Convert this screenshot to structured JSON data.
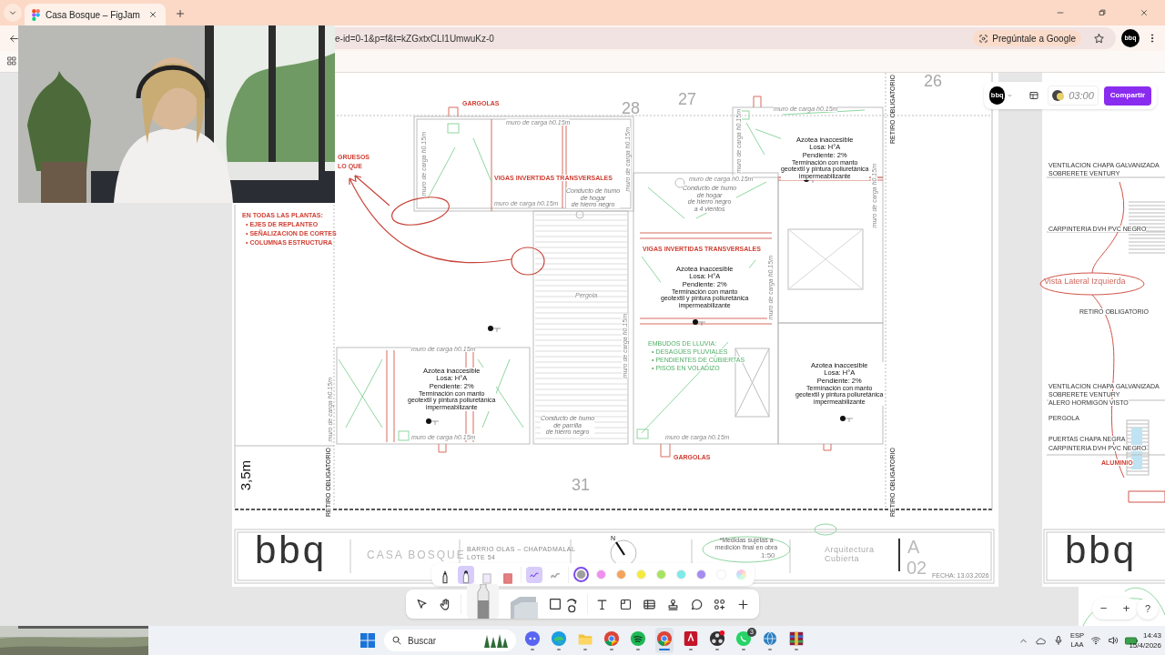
{
  "browser": {
    "tab_title": "Casa Bosque – FigJam",
    "url": "e-id=0-1&p=f&t=kZGxtxCLI1UmwuKz-0",
    "ask_google": "Pregúntale a Google",
    "profile": "bbq"
  },
  "figjam_header": {
    "avatar": "bbq",
    "timer": "03:00",
    "share": "Compartir"
  },
  "plan_labels": [
    {
      "kind": "red",
      "text": "GARGOLAS"
    },
    {
      "kind": "red-large",
      "text": "GRUESOS"
    },
    {
      "kind": "red-large",
      "text": "LO QUE"
    },
    {
      "kind": "red-large",
      "text": "EN TODAS LAS PLANTAS:"
    },
    {
      "kind": "red-large",
      "text": "• EJES DE REPLANTEO"
    },
    {
      "kind": "red-large",
      "text": "• SEÑALIZACION DE CORTES"
    },
    {
      "kind": "red-large",
      "text": "• COLUMNAS ESTRUCTURA"
    },
    {
      "kind": "wall",
      "text": "muro de carga h0.15m"
    },
    {
      "kind": "red",
      "text": "VIGAS INVERTIDAS TRANSVERSALES"
    },
    {
      "kind": "wall",
      "text": "muro de carga h0.15m"
    },
    {
      "kind": "wall",
      "text": "muro de carga h0.15m"
    },
    {
      "kind": "wall",
      "text": "muro de carga h0.15m"
    },
    {
      "kind": "wall",
      "text": "muro de carga h0.15m"
    },
    {
      "kind": "wall",
      "text": "muro de carga h0.15m"
    },
    {
      "kind": "wall",
      "text": "muro de carga h0.15m"
    },
    {
      "kind": "wall",
      "text": "muro de carga h0.15m"
    },
    {
      "kind": "red",
      "text": "VIGAS INVERTIDAS TRANSVERSALES"
    },
    {
      "kind": "wall",
      "text": "muro de carga h0.15m"
    },
    {
      "kind": "wall",
      "text": "muro de carga h0.15m"
    },
    {
      "kind": "wall",
      "text": "Pergola"
    },
    {
      "kind": "green",
      "text": "EMBUDOS DE LLUVIA:"
    },
    {
      "kind": "green",
      "text": "• DESAGÜES PLUVIALES"
    },
    {
      "kind": "green",
      "text": "• PENDIENTES DE CUBIERTAS"
    },
    {
      "kind": "green",
      "text": "• PISOS EN VOLADIZO"
    },
    {
      "kind": "wall",
      "text": "muro de carga h0.15m"
    },
    {
      "kind": "wall",
      "text": "muro de carga h0.15m"
    },
    {
      "kind": "wall",
      "text": "muro de carga h0.15m"
    },
    {
      "kind": "wall",
      "text": "muro de carga h0.15m"
    },
    {
      "kind": "red",
      "text": "GARGOLAS"
    },
    {
      "kind": "setback",
      "text": "RETIRO OBLIGATORIO"
    },
    {
      "kind": "setback",
      "text": "RETIRO OBLIGATORIO"
    },
    {
      "kind": "setback",
      "text": "RETIRO OBLIGATORIO"
    },
    {
      "kind": "dimension",
      "text": "3,5m"
    },
    {
      "kind": "stamp",
      "text": "28"
    },
    {
      "kind": "stamp",
      "text": "27"
    },
    {
      "kind": "stamp",
      "text": "26"
    },
    {
      "kind": "stamp",
      "text": "31"
    },
    {
      "kind": "material",
      "text": "VENTILACION CHAPA GALVANIZADA"
    },
    {
      "kind": "material",
      "text": "SOBRERETE VENTURY"
    },
    {
      "kind": "material",
      "text": "CARPINTERIA DVH PVC NEGRO"
    },
    {
      "kind": "view-title",
      "text": "Vista Lateral Izquierda"
    },
    {
      "kind": "material",
      "text": "RETIRO OBLIGATORIO"
    },
    {
      "kind": "material",
      "text": "VENTILACION CHAPA GALVANIZADA"
    },
    {
      "kind": "material",
      "text": "SOBRERETE VENTURY"
    },
    {
      "kind": "material",
      "text": "ALERO HORMIGON VISTO"
    },
    {
      "kind": "material",
      "text": "PERGOLA"
    },
    {
      "kind": "material",
      "text": "PUERTAS CHAPA NEGRA"
    },
    {
      "kind": "material",
      "text": "CARPINTERIA DVH PVC NEGRO"
    },
    {
      "kind": "red",
      "text": "ALUMINIO"
    }
  ],
  "plan_notes": [
    {
      "kind": "conduit",
      "lines": [
        "Conducto de humo",
        "de hogar",
        "de hierro negro"
      ]
    },
    {
      "kind": "conduit",
      "lines": [
        "Conducto de humo",
        "de hogar",
        "de hierro negro",
        "a 4 vientos"
      ]
    },
    {
      "kind": "conduit",
      "lines": [
        "Conducto de humo",
        "de parrilla",
        "de hierro negro"
      ]
    },
    {
      "kind": "roof",
      "lines": [
        "Azotea inaccesible",
        "Losa: H°A",
        "Pendiente: 2%",
        "Terminación con manto",
        "geotextil y pintura poliuretánica",
        "impermeabilizante"
      ]
    },
    {
      "kind": "roof",
      "lines": [
        "Azotea inaccesible",
        "Losa: H°A",
        "Pendiente: 2%",
        "Terminación con manto",
        "geotextil y pintura poliuretánica",
        "impermeabilizante"
      ]
    },
    {
      "kind": "roof",
      "lines": [
        "Azotea inaccesible",
        "Losa: H°A",
        "Pendiente: 2%",
        "Terminación con manto",
        "geotextil y pintura poliuretánica",
        "impermeabilizante"
      ]
    },
    {
      "kind": "roof",
      "lines": [
        "Azotea inaccesible",
        "Losa: H°A",
        "Pendiente: 2%",
        "Terminación con manto",
        "geotextil y pintura poliuretánica",
        "impermeabilizante"
      ]
    }
  ],
  "title_block": {
    "logo": "bbq",
    "project": "CASA BOSQUE",
    "location": "BARRIO OLAS – CHAPADMALAL",
    "lot": "LOTE 54",
    "north": "N",
    "note": "*Medidas sujetas a medición final en obra",
    "scale": "1:50",
    "sheet_title": "Arquitectura",
    "sheet_subtitle": "Cubierta",
    "sheet_letter": "A",
    "sheet_number": "02",
    "date": "FECHA: 13.03.2026"
  },
  "second_board": {
    "logo": "bbq"
  },
  "pen_toolbar": {
    "pen_tools": [
      {
        "kind": "pen",
        "selected": false
      },
      {
        "kind": "marker",
        "selected": true
      },
      {
        "kind": "highlighter",
        "selected": false
      },
      {
        "kind": "eraser",
        "selected": false
      }
    ],
    "stroke_styles": [
      {
        "kind": "smooth",
        "selected": true
      },
      {
        "kind": "rough",
        "selected": false
      }
    ],
    "colors": [
      {
        "kind": "swatch",
        "color": "#9e9e9e",
        "selected": true
      },
      {
        "kind": "swatch",
        "color": "#f28ef0",
        "selected": false
      },
      {
        "kind": "swatch",
        "color": "#f4a35c",
        "selected": false
      },
      {
        "kind": "swatch",
        "color": "#f5ea3c",
        "selected": false
      },
      {
        "kind": "swatch",
        "color": "#a6e35f",
        "selected": false
      },
      {
        "kind": "swatch",
        "color": "#7eeaea",
        "selected": false
      },
      {
        "kind": "swatch",
        "color": "#a58cf0",
        "selected": false
      },
      {
        "kind": "swatch",
        "color": "#ffffff",
        "selected": false
      },
      {
        "kind": "picker",
        "selected": false
      }
    ]
  },
  "toolbar": {
    "tools": [
      {
        "kind": "select",
        "selected": false
      },
      {
        "kind": "hand",
        "selected": false
      },
      {
        "kind": "marker",
        "selected": true
      },
      {
        "kind": "stickies",
        "selected": false
      },
      {
        "kind": "shapes",
        "selected": false
      },
      {
        "kind": "text",
        "selected": false
      },
      {
        "kind": "section",
        "selected": false
      },
      {
        "kind": "table",
        "selected": false
      },
      {
        "kind": "stamp",
        "selected": false
      },
      {
        "kind": "comment",
        "selected": false
      },
      {
        "kind": "more",
        "selected": false
      },
      {
        "kind": "add",
        "selected": false
      }
    ]
  },
  "zoom_controls": {
    "zoom_out": "−",
    "zoom_in": "+",
    "help": "?"
  },
  "taskbar": {
    "search": "Buscar",
    "apps": [
      {
        "kind": "discord",
        "active": false
      },
      {
        "kind": "edge",
        "active": false
      },
      {
        "kind": "files",
        "active": false
      },
      {
        "kind": "chrome",
        "active": false
      },
      {
        "kind": "spotify",
        "active": false
      },
      {
        "kind": "chrome",
        "active": true
      },
      {
        "kind": "cad",
        "active": false
      },
      {
        "kind": "obs",
        "active": false
      },
      {
        "kind": "whatsapp",
        "active": false,
        "badge": "3"
      },
      {
        "kind": "globe",
        "active": false
      },
      {
        "kind": "archive",
        "active": false
      }
    ],
    "language": "ESP",
    "layout": "LAA",
    "time": "14:43",
    "date": "15/4/2026"
  }
}
